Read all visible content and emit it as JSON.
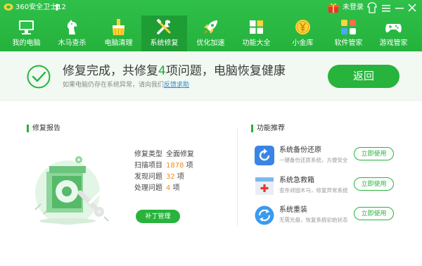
{
  "titlebar": {
    "app_title": "360安全卫士12",
    "login_text": "未登录"
  },
  "nav": {
    "items": [
      {
        "label": "我的电脑",
        "icon": "monitor-icon"
      },
      {
        "label": "木马查杀",
        "icon": "trojan-horse-icon"
      },
      {
        "label": "电脑清理",
        "icon": "cleanup-icon"
      },
      {
        "label": "系统修复",
        "icon": "tools-icon"
      },
      {
        "label": "优化加速",
        "icon": "rocket-icon"
      },
      {
        "label": "功能大全",
        "icon": "apps-grid-icon"
      },
      {
        "label": "小金库",
        "icon": "coin-icon"
      },
      {
        "label": "软件管家",
        "icon": "software-icon"
      },
      {
        "label": "游戏管家",
        "icon": "gamepad-icon"
      }
    ],
    "active_index": 3
  },
  "banner": {
    "status_prefix": "修复完成，共修复",
    "status_count": "4",
    "status_suffix": "项问题，电脑恢复健康",
    "sub_text": "如果电脑仍存在系统异常，请向我们",
    "feedback_link": "反馈求助",
    "back_button": "返回"
  },
  "report": {
    "title": "修复报告",
    "rows": [
      {
        "label": "修复类型",
        "value": "全面修复",
        "highlight": "",
        "unit": ""
      },
      {
        "label": "扫描项目",
        "value": "",
        "highlight": "1878",
        "unit": "项"
      },
      {
        "label": "发现问题",
        "value": "",
        "highlight": "32",
        "unit": "项"
      },
      {
        "label": "处理问题",
        "value": "",
        "highlight": "4",
        "unit": "项"
      }
    ],
    "patch_button": "补丁管理"
  },
  "recommend": {
    "title": "功能推荐",
    "items": [
      {
        "name": "系统备份还原",
        "desc": "一键备份还原系统，方便安全",
        "button": "立即使用",
        "icon": "backup-restore-icon"
      },
      {
        "name": "系统急救箱",
        "desc": "查杀顽固木马，修复异常系统",
        "button": "立即使用",
        "icon": "first-aid-kit-icon"
      },
      {
        "name": "系统重装",
        "desc": "无需光盘，恢复系统初始状态",
        "button": "立即使用",
        "icon": "reinstall-icon"
      }
    ]
  },
  "colors": {
    "brand_green": "#27b33c",
    "highlight_orange": "#f08c1e",
    "link_blue": "#2f86d6"
  }
}
